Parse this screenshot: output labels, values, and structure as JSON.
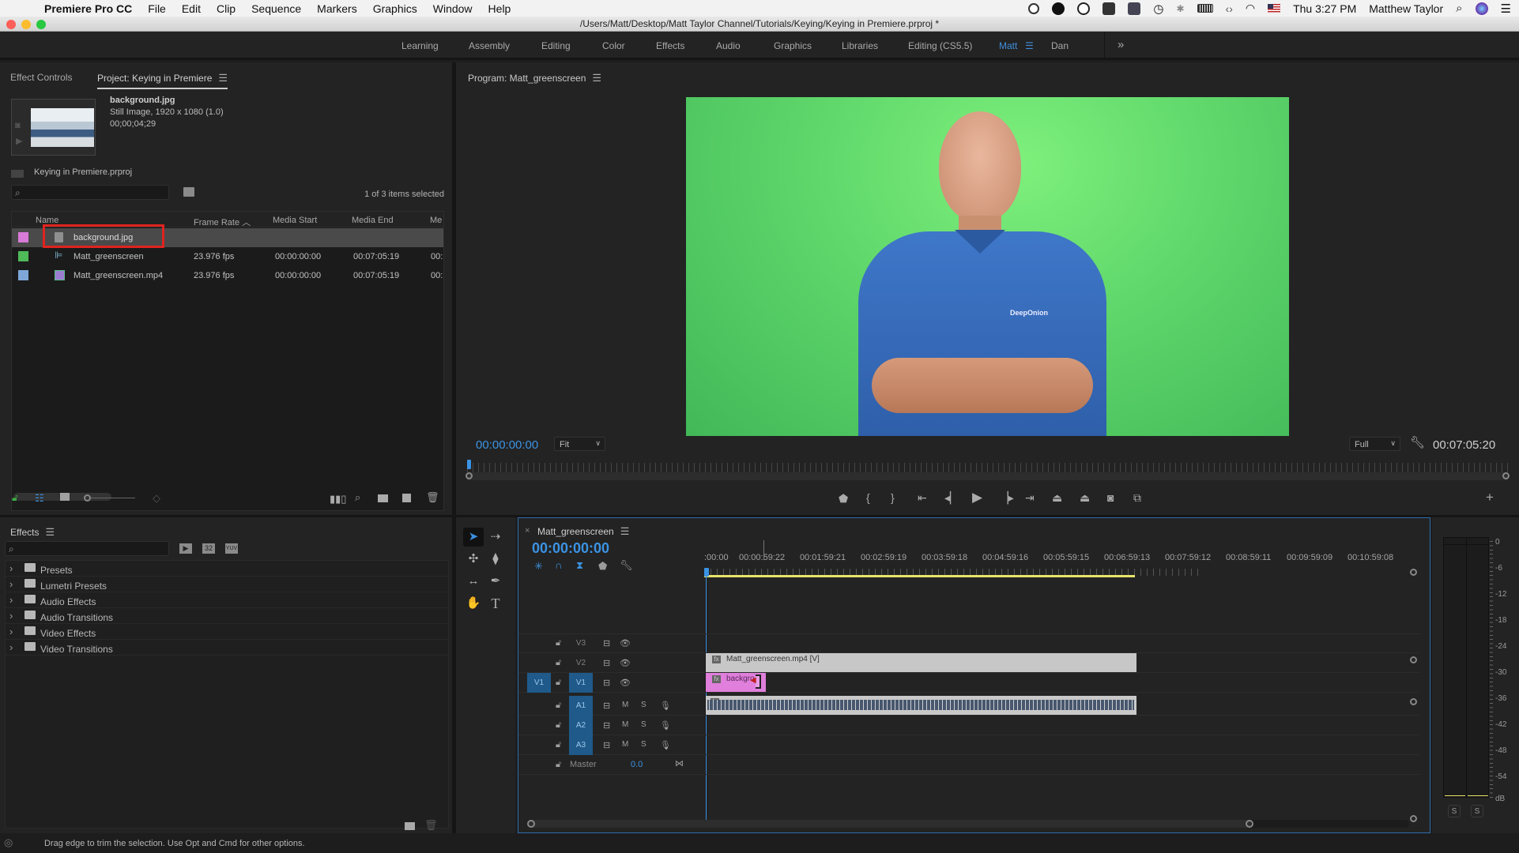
{
  "menubar": {
    "app_name": "Premiere Pro CC",
    "menus": [
      "File",
      "Edit",
      "Clip",
      "Sequence",
      "Markers",
      "Graphics",
      "Window",
      "Help"
    ],
    "clock": "Thu 3:27 PM",
    "user": "Matthew Taylor"
  },
  "window": {
    "title": "/Users/Matt/Desktop/Matt Taylor Channel/Tutorials/Keying/Keying in Premiere.prproj *"
  },
  "workspaces": {
    "tabs": [
      "Learning",
      "Assembly",
      "Editing",
      "Color",
      "Effects",
      "Audio",
      "Graphics",
      "Libraries",
      "Editing (CS5.5)",
      "Matt",
      "Dan"
    ],
    "active": "Matt",
    "overflow": "»"
  },
  "project_panel": {
    "tabs": [
      "Effect Controls",
      "Project: Keying in Premiere"
    ],
    "active_tab": "Project: Keying in Premiere",
    "preview": {
      "name": "background.jpg",
      "info": "Still Image, 1920 x 1080 (1.0)",
      "duration": "00;00;04;29"
    },
    "project_file": "Keying in Premiere.prproj",
    "search_placeholder": "",
    "selection_status": "1 of 3 items selected",
    "columns": [
      "Name",
      "Frame Rate",
      "Media Start",
      "Media End",
      "Me"
    ],
    "items": [
      {
        "name": "background.jpg",
        "frame_rate": "",
        "media_start": "",
        "media_end": "",
        "extra": "",
        "color": "#d87bd8",
        "selected": true
      },
      {
        "name": "Matt_greenscreen",
        "frame_rate": "23.976 fps",
        "media_start": "00:00:00:00",
        "media_end": "00:07:05:19",
        "extra": "00:",
        "color": "#4fba58",
        "selected": false
      },
      {
        "name": "Matt_greenscreen.mp4",
        "frame_rate": "23.976 fps",
        "media_start": "00:00:00:00",
        "media_end": "00:07:05:19",
        "extra": "00:",
        "color": "#7ea7d8",
        "selected": false
      }
    ]
  },
  "effects_panel": {
    "title": "Effects",
    "search_placeholder": "",
    "badges": [
      "▶",
      "32",
      "YUV"
    ],
    "folders": [
      "Presets",
      "Lumetri Presets",
      "Audio Effects",
      "Audio Transitions",
      "Video Effects",
      "Video Transitions"
    ]
  },
  "program_monitor": {
    "title": "Program: Matt_greenscreen",
    "current_time": "00:00:00:00",
    "zoom": "Fit",
    "resolution": "Full",
    "duration": "00:07:05:20",
    "shirt_logo": "DeepOnion"
  },
  "timeline": {
    "sequence_name": "Matt_greenscreen",
    "current_time": "00:00:00:00",
    "ruler": [
      ":00:00",
      "00:00:59:22",
      "00:01:59:21",
      "00:02:59:19",
      "00:03:59:18",
      "00:04:59:16",
      "00:05:59:15",
      "00:06:59:13",
      "00:07:59:12",
      "00:08:59:11",
      "00:09:59:09",
      "00:10:59:08"
    ],
    "video_tracks": [
      {
        "label": "V3",
        "source": ""
      },
      {
        "label": "V2",
        "source": ""
      },
      {
        "label": "V1",
        "source": "V1"
      }
    ],
    "audio_tracks": [
      {
        "label": "A1",
        "m": "M",
        "s": "S"
      },
      {
        "label": "A2",
        "m": "M",
        "s": "S"
      },
      {
        "label": "A3",
        "m": "M",
        "s": "S"
      }
    ],
    "master": {
      "label": "Master",
      "value": "0.0"
    },
    "clips": {
      "v2": "Matt_greenscreen.mp4 [V]",
      "v1": "backgro",
      "fx": "fx"
    }
  },
  "audio_meter": {
    "scale": [
      "0",
      "-6",
      "-12",
      "-18",
      "-24",
      "-30",
      "-36",
      "-42",
      "-48",
      "-54",
      "dB"
    ],
    "solo": [
      "S",
      "S"
    ]
  },
  "status_bar": {
    "message": "Drag edge to trim the selection. Use Opt and Cmd for other options."
  },
  "colors": {
    "accent_blue": "#3b93e3",
    "background_clip": "#e07fdc",
    "video_clip": "#c7c7c7",
    "selection_red": "#e0231e",
    "greenscreen": "#5fd36a",
    "work_area": "#e8e36a"
  }
}
